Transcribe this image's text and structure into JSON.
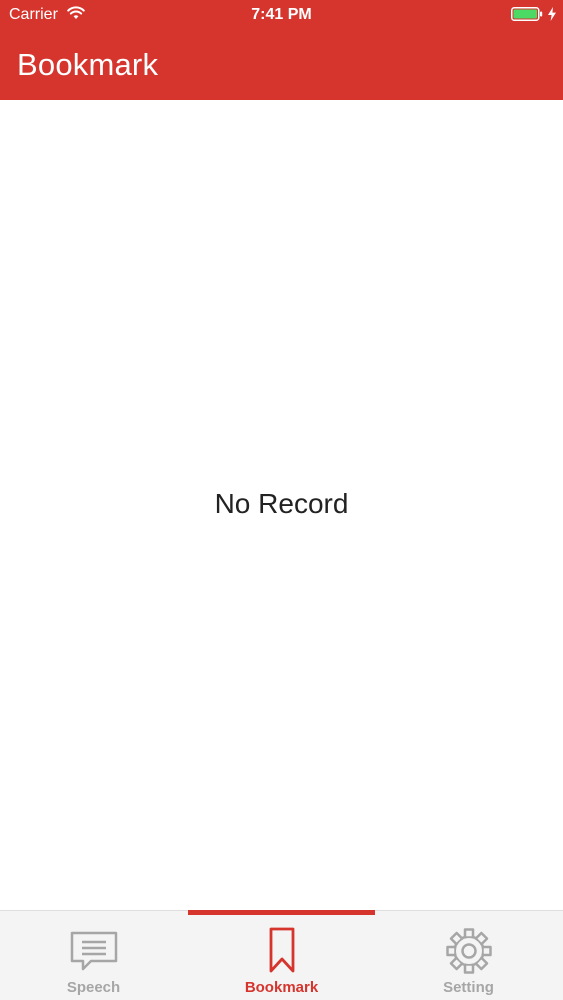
{
  "status_bar": {
    "carrier": "Carrier",
    "time": "7:41 PM",
    "wifi_icon": "wifi-icon",
    "battery_icon": "battery-icon",
    "charging_icon": "charging-icon"
  },
  "nav": {
    "title": "Bookmark"
  },
  "content": {
    "empty_message": "No Record"
  },
  "tabs": [
    {
      "label": "Speech",
      "icon": "speech-bubble-icon",
      "active": false
    },
    {
      "label": "Bookmark",
      "icon": "bookmark-icon",
      "active": true
    },
    {
      "label": "Setting",
      "icon": "gear-icon",
      "active": false
    }
  ],
  "colors": {
    "brand": "#d6352e",
    "inactive_tab": "#a6a6a6",
    "battery": "#4cd964"
  }
}
